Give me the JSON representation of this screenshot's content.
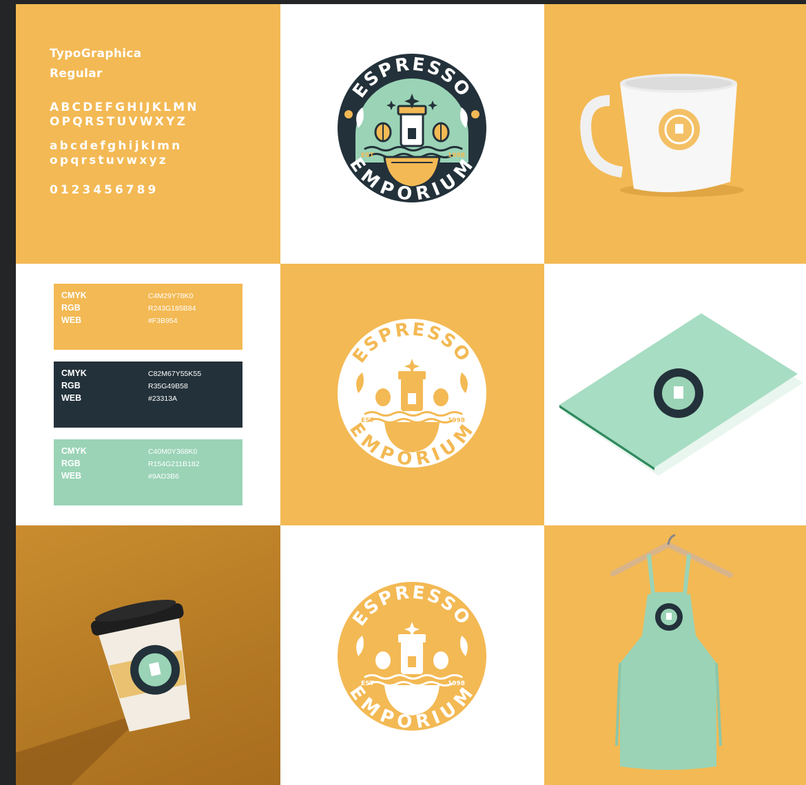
{
  "typography": {
    "font_name_line1": "TypoGraphica",
    "font_name_line2": "Regular",
    "uppercase_line1": "ABCDEFGHIJKLMN",
    "uppercase_line2": "OPQRSTUVWXYZ",
    "lowercase_line1": "abcdefghijklmn",
    "lowercase_line2": "opqrstuvwxyz",
    "digits": "0123456789"
  },
  "palette": [
    {
      "cmyk_label": "CMYK",
      "rgb_label": "RGB",
      "web_label": "WEB",
      "cmyk": "C4M29Y78K0",
      "rgb": "R243G185B84",
      "web": "#F3B954",
      "color": "#F3B954"
    },
    {
      "cmyk_label": "CMYK",
      "rgb_label": "RGB",
      "web_label": "WEB",
      "cmyk": "C82M67Y55K55",
      "rgb": "R35G49B58",
      "web": "#23313A",
      "color": "#23313A"
    },
    {
      "cmyk_label": "CMYK",
      "rgb_label": "RGB",
      "web_label": "WEB",
      "cmyk": "C40M0Y368K0",
      "rgb": "R154G211B182",
      "web": "#9AD3B6",
      "color": "#9AD3B6"
    }
  ],
  "logo": {
    "top_text": "ESPRESSO",
    "bottom_text": "EMPORIUM",
    "est": "EST",
    "year": "1998"
  },
  "colors": {
    "orange": "#F3B954",
    "navy": "#23313A",
    "mint": "#9AD3B6",
    "white": "#FFFFFF"
  }
}
